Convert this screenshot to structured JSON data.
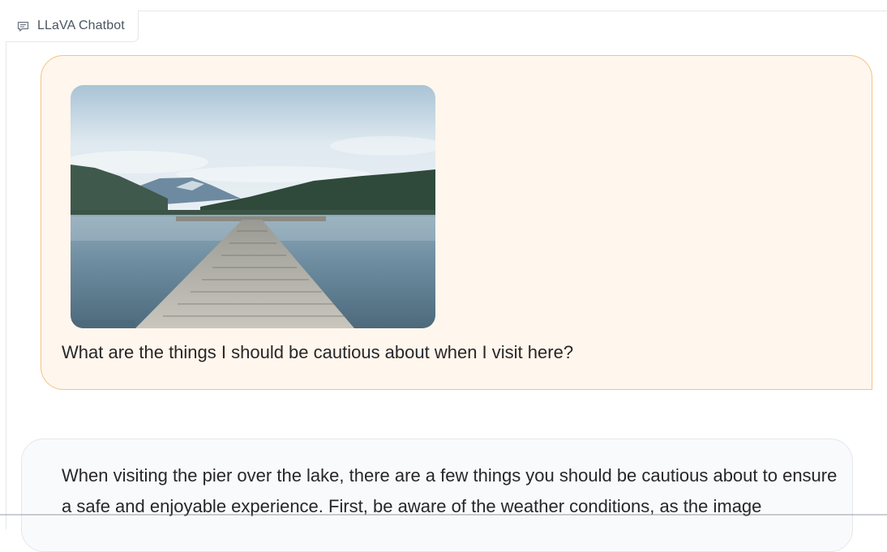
{
  "chatbot": {
    "label": "LLaVA Chatbot",
    "label_icon": "chat-bubble-icon"
  },
  "messages": [
    {
      "role": "user",
      "image": "lake-pier-photo",
      "text": "What are the things I should be cautious about when I visit here?"
    },
    {
      "role": "bot",
      "text": "When visiting the pier over the lake, there are a few things you should be cautious about to ensure a safe and enjoyable experience. First, be aware of the weather conditions, as the image"
    }
  ],
  "colors": {
    "user_bubble_bg": "#fff6ed",
    "user_bubble_border": "#f5c382",
    "bot_bubble_bg": "#f9fafb",
    "bot_bubble_border": "#e5e7eb"
  }
}
